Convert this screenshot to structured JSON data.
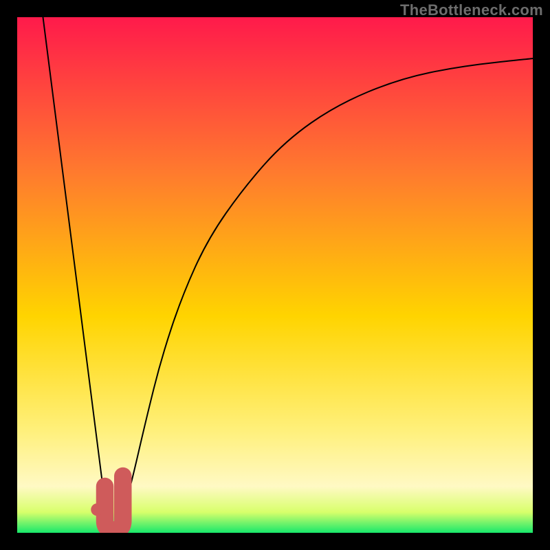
{
  "watermark": "TheBottleneck.com",
  "chart_data": {
    "type": "line",
    "title": "",
    "xlabel": "",
    "ylabel": "",
    "xlim": [
      0,
      100
    ],
    "ylim": [
      0,
      100
    ],
    "grid": false,
    "background_gradient": {
      "top": "#ff1a4b",
      "upper_mid": "#ff7a2e",
      "mid": "#ffd400",
      "lower_mid": "#fff07a",
      "bottom": "#17e86b"
    },
    "series": [
      {
        "name": "left-branch",
        "x": [
          5,
          17.5
        ],
        "y": [
          100,
          2
        ],
        "stroke": "#000000",
        "stroke_width": 2
      },
      {
        "name": "right-branch",
        "x": [
          20,
          22,
          25,
          28,
          32,
          37,
          44,
          52,
          62,
          74,
          86,
          100
        ],
        "y": [
          2,
          9,
          22,
          34,
          46,
          57,
          67,
          76,
          83,
          88,
          90.5,
          92
        ],
        "stroke": "#000000",
        "stroke_width": 2
      }
    ],
    "marker": {
      "name": "bottleneck-marker",
      "color": "#cf5b5b",
      "dot": {
        "x": 15.5,
        "y": 4.5,
        "r": 1.2
      },
      "hook": {
        "points": [
          {
            "x": 17.0,
            "y": 9.0
          },
          {
            "x": 17.0,
            "y": 2.3
          },
          {
            "x": 20.5,
            "y": 2.3
          },
          {
            "x": 20.5,
            "y": 11.0
          }
        ],
        "stroke_width": 3.4
      }
    }
  }
}
